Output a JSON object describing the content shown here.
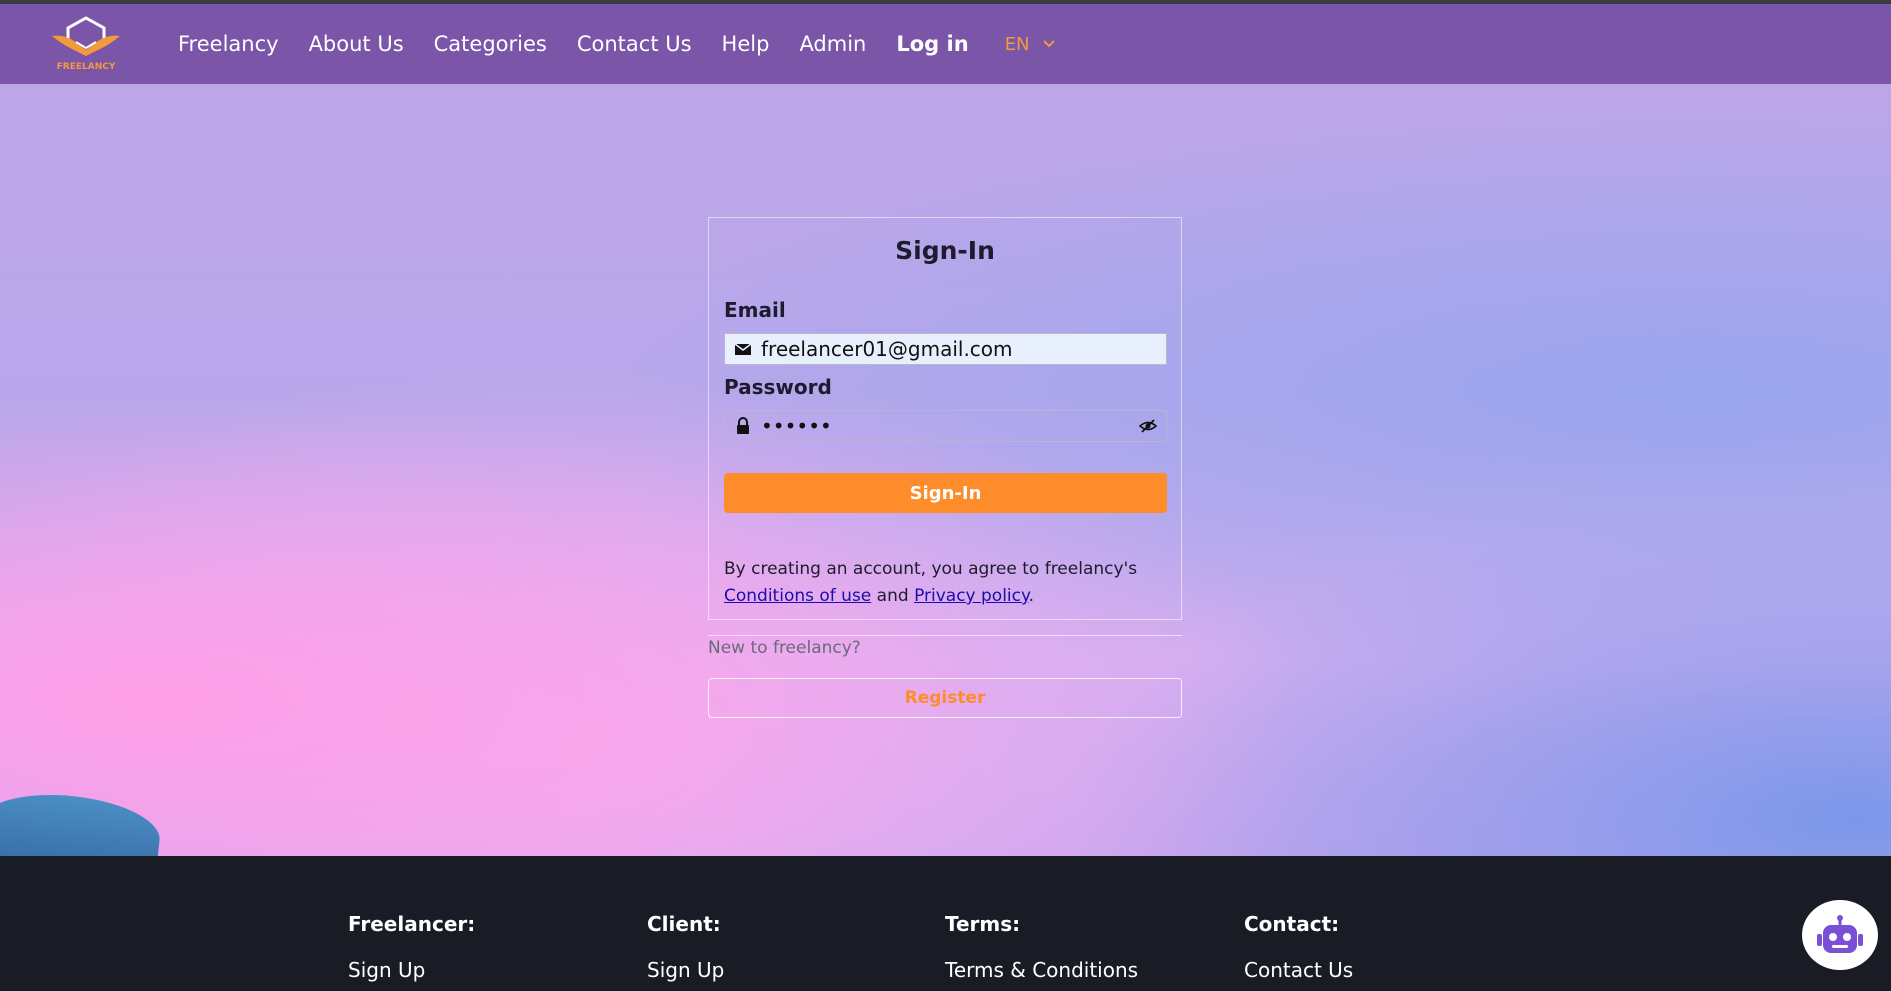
{
  "navbar": {
    "logo_text": "FREELANCY",
    "links": [
      "Freelancy",
      "About Us",
      "Categories",
      "Contact Us",
      "Help",
      "Admin",
      "Log in"
    ],
    "language": "EN"
  },
  "signin": {
    "title": "Sign-In",
    "email_label": "Email",
    "email_value": "freelancer01@gmail.com",
    "password_label": "Password",
    "password_value": "••••••",
    "button_label": "Sign-In",
    "terms_prefix": "By creating an account, you agree to freelancy's",
    "conditions_link": "Conditions of use",
    "and_text": " and ",
    "privacy_link": "Privacy policy",
    "period": "."
  },
  "register": {
    "prompt": "New to freelancy?",
    "button_label": "Register"
  },
  "footer": {
    "columns": [
      {
        "heading": "Freelancer:",
        "link": "Sign Up"
      },
      {
        "heading": "Client:",
        "link": "Sign Up"
      },
      {
        "heading": "Terms:",
        "link": "Terms & Conditions"
      },
      {
        "heading": "Contact:",
        "link": "Contact Us"
      }
    ]
  },
  "colors": {
    "navbar": "#7a55a8",
    "accent": "#ff8c2b",
    "footer": "#1a1c25"
  }
}
